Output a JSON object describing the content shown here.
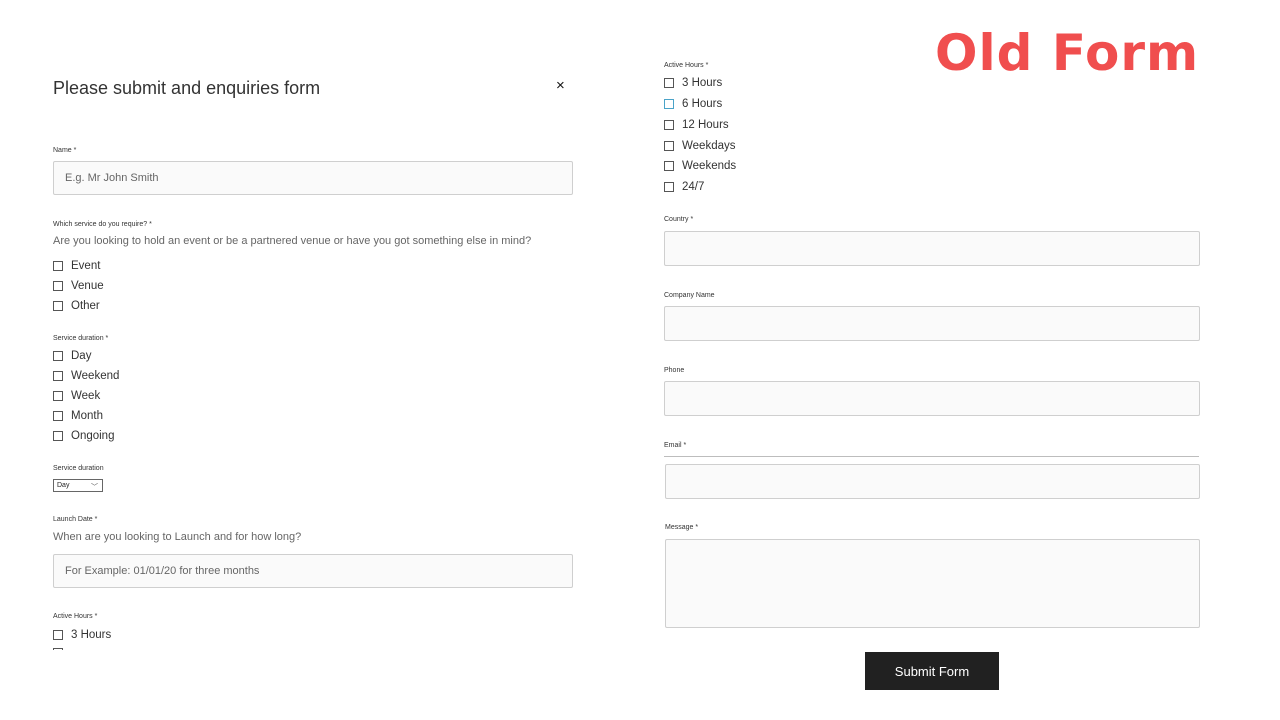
{
  "slide_label": "Old Form",
  "form": {
    "title": "Please submit and enquiries form",
    "close_glyph": "×",
    "name": {
      "label": "Name *",
      "placeholder": "E.g. Mr John Smith"
    },
    "service": {
      "label": "Which service do you require? *",
      "hint": "Are you looking to hold an event or be a partnered venue or have you got something else in mind?",
      "options": [
        "Event",
        "Venue",
        "Other"
      ]
    },
    "duration": {
      "label": "Service duration *",
      "options": [
        "Day",
        "Weekend",
        "Week",
        "Month",
        "Ongoing"
      ]
    },
    "duration_select": {
      "label": "Service duration",
      "value": "Day",
      "chevron": "﹀"
    },
    "launch": {
      "label": "Launch Date *",
      "hint": "When are you looking to Launch and for how long?",
      "placeholder": "For Example: 01/01/20 for three months"
    },
    "active_hours_left": {
      "label": "Active Hours *",
      "options": [
        "3 Hours"
      ]
    },
    "active_hours_right": {
      "label": "Active Hours *",
      "options": [
        "3 Hours",
        "6 Hours",
        "12 Hours",
        "Weekdays",
        "Weekends",
        "24/7"
      ]
    },
    "country": {
      "label": "Country *"
    },
    "company": {
      "label": "Company Name"
    },
    "phone": {
      "label": "Phone"
    },
    "email": {
      "label": "Email *"
    },
    "message": {
      "label": "Message *"
    },
    "submit_label": "Submit Form"
  },
  "colors": {
    "accent_red": "#f04e4e",
    "button_bg": "#212121",
    "checkbox_focus": "#4aa3c8"
  }
}
